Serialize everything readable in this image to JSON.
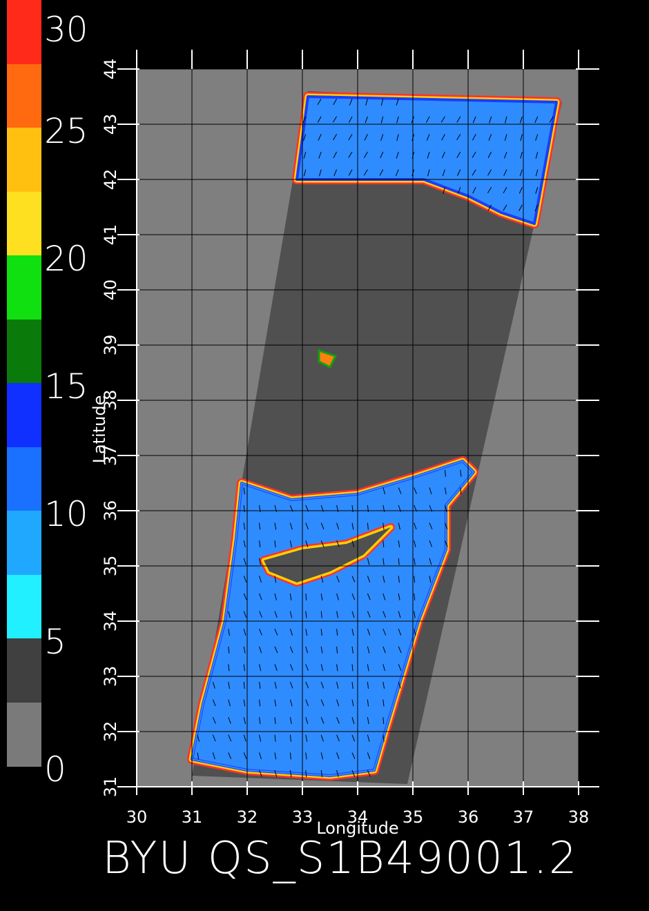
{
  "colorbar": {
    "labels": [
      "30",
      "25",
      "20",
      "15",
      "10",
      "5",
      "0"
    ],
    "segments": [
      {
        "from": 27.5,
        "to": 30,
        "color": "#ff2a1a"
      },
      {
        "from": 25,
        "to": 27.5,
        "color": "#ff6a10"
      },
      {
        "from": 22.5,
        "to": 25,
        "color": "#ffc010"
      },
      {
        "from": 20,
        "to": 22.5,
        "color": "#ffe020"
      },
      {
        "from": 17.5,
        "to": 20,
        "color": "#10e010"
      },
      {
        "from": 15,
        "to": 17.5,
        "color": "#0a7a0a"
      },
      {
        "from": 12.5,
        "to": 15,
        "color": "#1030ff"
      },
      {
        "from": 10,
        "to": 12.5,
        "color": "#1a70ff"
      },
      {
        "from": 7.5,
        "to": 10,
        "color": "#20a8ff"
      },
      {
        "from": 5,
        "to": 7.5,
        "color": "#20f0ff"
      },
      {
        "from": 2.5,
        "to": 5,
        "color": "#404040"
      },
      {
        "from": 0,
        "to": 2.5,
        "color": "#7a7a7a"
      }
    ]
  },
  "chart_data": {
    "type": "heatmap",
    "xlabel": "Longitude",
    "ylabel": "Latitude",
    "xlim": [
      30,
      38
    ],
    "ylim": [
      31,
      44
    ],
    "x_ticks": [
      "30",
      "31",
      "32",
      "33",
      "34",
      "35",
      "36",
      "37",
      "38"
    ],
    "y_ticks": [
      "31",
      "32",
      "33",
      "34",
      "35",
      "36",
      "37",
      "38",
      "39",
      "40",
      "41",
      "42",
      "43",
      "44"
    ],
    "grid": true,
    "colors": {
      "land": "#7f7f7f",
      "swath_land": "#505050",
      "sea": "#2f8cff",
      "coast": "#ffd000",
      "vector": "#000000",
      "grid": "#000000"
    },
    "swath_corners_lonlat": [
      [
        33.1,
        43.6
      ],
      [
        37.7,
        43.4
      ],
      [
        34.9,
        31.05
      ],
      [
        31.0,
        31.2
      ]
    ],
    "black_sea_region": [
      [
        33.1,
        43.5
      ],
      [
        37.6,
        43.4
      ],
      [
        37.2,
        41.2
      ],
      [
        36.6,
        41.4
      ],
      [
        36.0,
        41.7
      ],
      [
        35.2,
        42.0
      ],
      [
        34.2,
        42.0
      ],
      [
        33.2,
        42.0
      ],
      [
        32.9,
        42.0
      ]
    ],
    "mediterranean_region": [
      [
        31.9,
        36.5
      ],
      [
        32.8,
        36.2
      ],
      [
        34.0,
        36.3
      ],
      [
        35.0,
        36.6
      ],
      [
        35.9,
        36.9
      ],
      [
        36.1,
        36.7
      ],
      [
        35.6,
        36.1
      ],
      [
        35.6,
        35.3
      ],
      [
        35.1,
        34.0
      ],
      [
        34.8,
        33.0
      ],
      [
        34.5,
        32.0
      ],
      [
        34.3,
        31.3
      ],
      [
        33.5,
        31.2
      ],
      [
        32.0,
        31.3
      ],
      [
        31.0,
        31.5
      ],
      [
        31.2,
        32.5
      ],
      [
        31.6,
        34.0
      ],
      [
        31.8,
        35.5
      ]
    ],
    "cyprus_island": [
      [
        32.3,
        35.1
      ],
      [
        33.0,
        35.3
      ],
      [
        33.8,
        35.4
      ],
      [
        34.6,
        35.7
      ],
      [
        34.1,
        35.2
      ],
      [
        33.5,
        34.9
      ],
      [
        32.9,
        34.7
      ],
      [
        32.4,
        34.9
      ]
    ],
    "inland_lake": [
      [
        33.3,
        38.9
      ],
      [
        33.6,
        38.8
      ],
      [
        33.5,
        38.6
      ],
      [
        33.3,
        38.7
      ]
    ]
  },
  "footer": {
    "text": "BYU QS_S1B49001.2"
  }
}
